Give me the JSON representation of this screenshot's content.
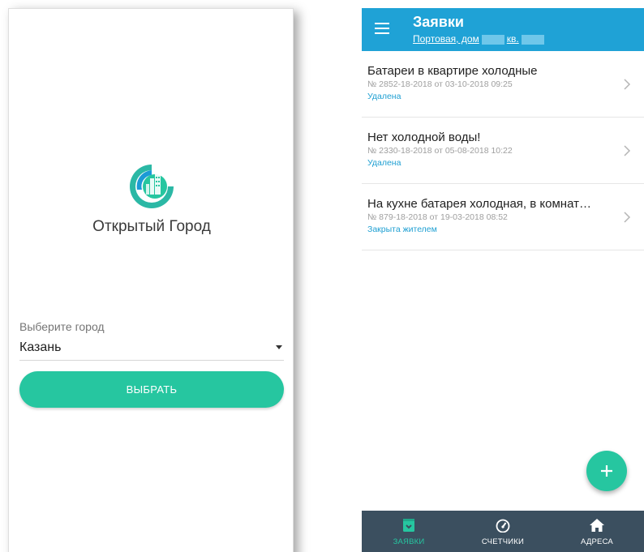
{
  "left": {
    "app_name": "Открытый Город",
    "city_label": "Выберите город",
    "city_value": "Казань",
    "choose_button": "ВЫБРАТЬ"
  },
  "right": {
    "header": {
      "title": "Заявки",
      "address_prefix": "Портовая, дом",
      "address_suffix": "кв."
    },
    "requests": [
      {
        "title": "Батареи в квартире холодные",
        "meta": "№ 2852-18-2018 от 03-10-2018 09:25",
        "status": "Удалена"
      },
      {
        "title": "Нет холодной воды!",
        "meta": "№ 2330-18-2018 от 05-08-2018 10:22",
        "status": "Удалена"
      },
      {
        "title": "На кухне батарея холодная, в комнат…",
        "meta": "№ 879-18-2018 от 19-03-2018 08:52",
        "status": "Закрыта жителем"
      }
    ],
    "nav": {
      "requests": "ЗАЯВКИ",
      "meters": "СЧЕТЧИКИ",
      "addresses": "АДРЕСА"
    }
  },
  "colors": {
    "accent_green": "#26c6a0",
    "header_blue": "#1fa2d6",
    "nav_background": "#3b4f5f",
    "status_blue": "#1e9fd2"
  },
  "icons": [
    "city-logo-icon",
    "menu-icon",
    "chevron-right-icon",
    "plus-icon",
    "inbox-icon",
    "speedometer-icon",
    "home-icon",
    "dropdown-caret-icon"
  ]
}
